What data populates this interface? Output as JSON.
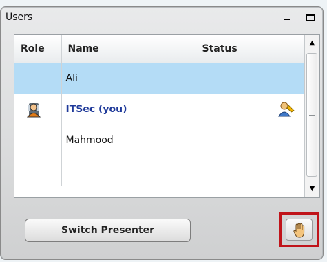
{
  "window": {
    "title": "Users"
  },
  "table": {
    "headers": {
      "role": "Role",
      "name": "Name",
      "status": "Status"
    },
    "rows": [
      {
        "role_icon": "",
        "name": "Ali",
        "status_icon": ""
      },
      {
        "role_icon": "presenter-icon",
        "name": "ITSec (you)",
        "status_icon": "user-status-icon"
      },
      {
        "role_icon": "",
        "name": "Mahmood",
        "status_icon": ""
      },
      {
        "role_icon": "",
        "name": "",
        "status_icon": ""
      }
    ]
  },
  "actions": {
    "switch_presenter": "Switch Presenter",
    "raise_hand_icon": "raise-hand-icon"
  },
  "colors": {
    "selected_row": "#b4dcf6",
    "current_user": "#1f3a9a",
    "highlight_border": "#c0141a"
  }
}
